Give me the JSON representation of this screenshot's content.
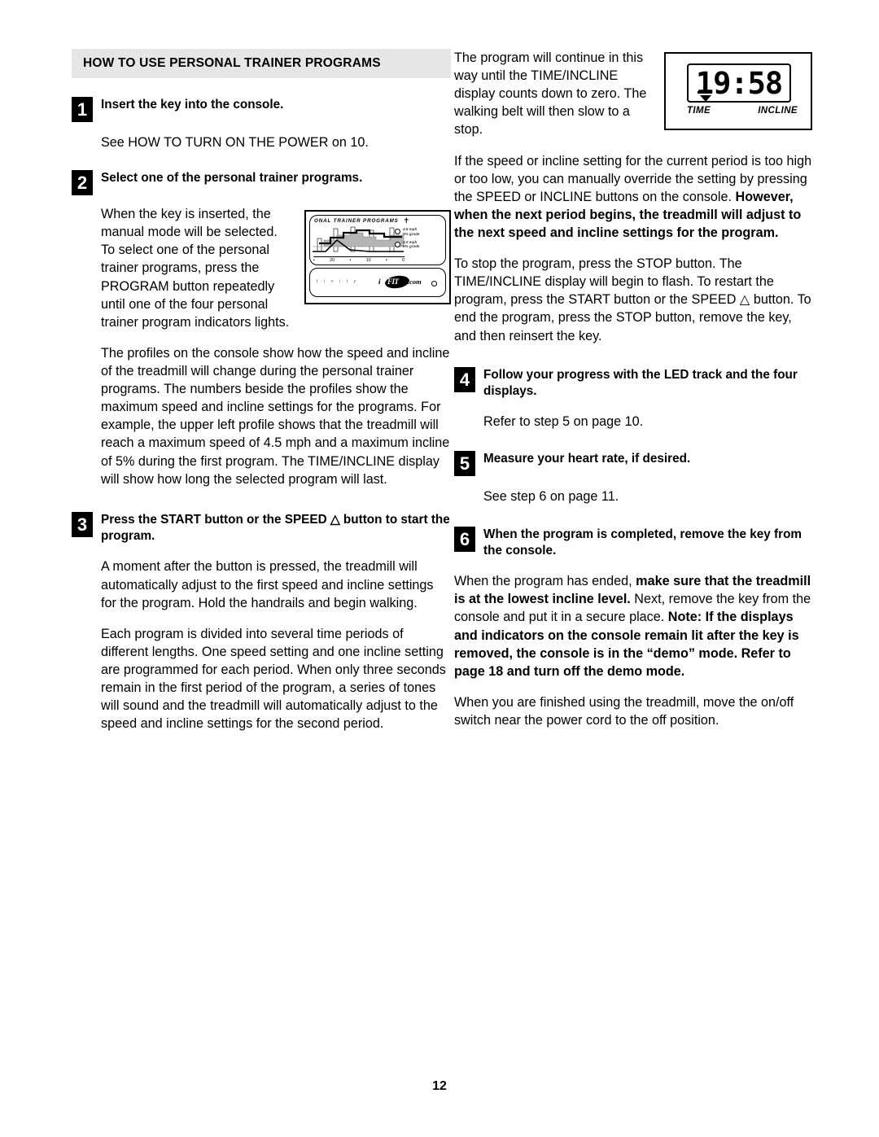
{
  "page": {
    "number": "12",
    "section_header": "HOW TO USE PERSONAL TRAINER PROGRAMS"
  },
  "left_column": {
    "step1": {
      "badge": "1",
      "title": "Insert the key into the console.",
      "body": "See HOW TO TURN ON THE POWER on 10."
    },
    "step2": {
      "badge": "2",
      "title": "Select one of the personal trainer programs.",
      "body1": "When the key is inserted, the manual mode will be selected. To select one of the personal trainer programs, press the PROGRAM button repeatedly until one of the four personal trainer program indicators lights.",
      "body2": "The profiles on the console show how the speed and incline of the treadmill will change during the personal trainer programs. The numbers beside the profiles show the maximum speed and incline settings for the programs. For example, the upper left profile shows that the treadmill will reach a maximum speed of 4.5 mph and a maximum incline of 5% during the first program. The TIME/INCLINE display will show how long the selected program will last."
    },
    "step3": {
      "badge": "3",
      "title_part1": "Press the START button or the SPEED ",
      "title_triangle": "△",
      "title_part2": " button to start the program.",
      "body1": "A moment after the button is pressed, the treadmill will automatically adjust to the first speed and incline settings for the program. Hold the handrails and begin walking.",
      "body2": "Each program is divided into several time periods of different lengths. One speed setting and one incline setting are programmed for each period. When only three seconds remain in the first period of the program, a series of tones will sound and the treadmill will automatically adjust to the speed and incline settings for the second period."
    }
  },
  "console_art": {
    "panel_title": "ONAL TRAINER PROGRAMS",
    "runner_icon": "runner-icon",
    "scale_ticks": [
      "•",
      "20",
      "•",
      "10",
      "•",
      "0"
    ],
    "legend": [
      {
        "line1": "4.5 mph",
        "line2": "5% grade"
      },
      {
        "line1": "4.0 mph",
        "line2": "5% grade"
      }
    ],
    "bottom_panel_text": "t i v i t y",
    "logo_i": "i",
    "logo_fit": "FIT",
    "logo_com": ".com"
  },
  "right_column": {
    "para1": "The program will continue in this way until the TIME/INCLINE display counts down to zero. The walking belt will then slow to a stop.",
    "para2_plain1": "If the speed or incline setting for the current period is too high or too low, you can manually override the setting by pressing the SPEED or INCLINE buttons on the console. ",
    "para2_bold": "However, when the next period begins, the treadmill will adjust to the next speed and incline settings for the program.",
    "para3_part1": "To stop the program, press the STOP button. The TIME/INCLINE display will begin to flash. To restart the program, press the START button or the SPEED ",
    "para3_triangle": "△",
    "para3_part2": " button. To end the program, press the STOP button, remove the key, and then reinsert the key.",
    "step4": {
      "badge": "4",
      "title": "Follow your progress with the LED track and the four displays.",
      "body": "Refer to step 5 on page 10."
    },
    "step5": {
      "badge": "5",
      "title": "Measure your heart rate, if desired.",
      "body": "See step 6 on page 11."
    },
    "step6": {
      "badge": "6",
      "title": "When the program is completed, remove the key from the console.",
      "body_plain1": "When the program has ended, ",
      "body_bold1": "make sure that the treadmill is at the lowest incline level.",
      "body_plain2": " Next, remove the key from the console and put it in a secure place. ",
      "body_bold2": "Note: If the displays and indicators on the console remain lit after the key is removed, the console is in the “demo” mode. Refer to page 18 and turn off the demo mode.",
      "body_last": "When you are finished using the treadmill, move the on/off switch near the power cord to the off position."
    }
  },
  "led_display": {
    "value": "19:58",
    "label_left": "TIME",
    "label_right": "INCLINE"
  }
}
